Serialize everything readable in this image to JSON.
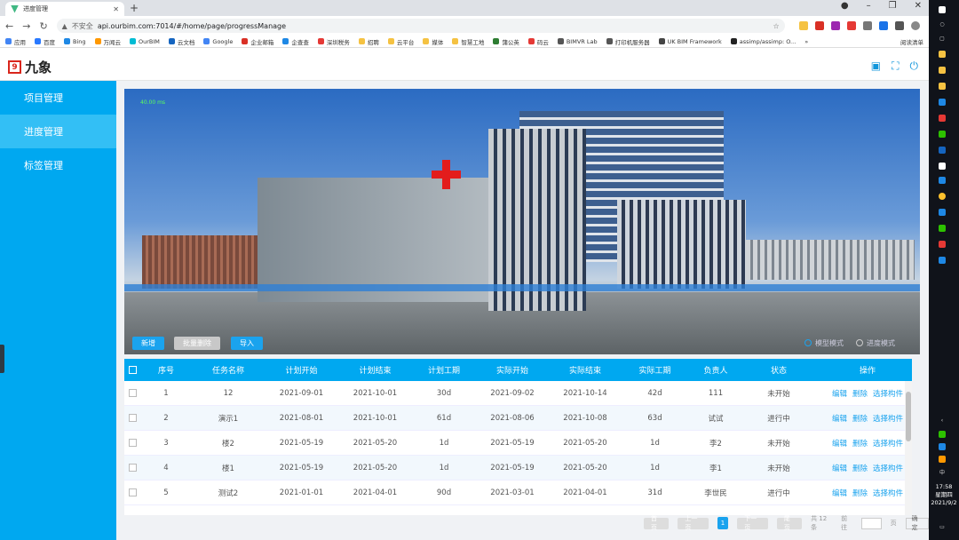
{
  "browser": {
    "tab_title": "进度管理",
    "new_tab": "+",
    "insecure_label": "不安全",
    "url": "api.ourbim.com:7014/#/home/page/progressManage",
    "bookmarks": [
      "应用",
      "百度",
      "Bing",
      "万闻云",
      "OurBIM",
      "云文档",
      "Google",
      "企业邮箱",
      "企查查",
      "深圳税务",
      "招聘",
      "云平台",
      "媒体",
      "智慧工地",
      "蒲公英",
      "码云",
      "BIMVR Lab",
      "打印机服务器",
      "UK BIM Framework",
      "assimp/assimp: O..."
    ],
    "more_bookmarks": "»",
    "reading_list": "阅读清单"
  },
  "app": {
    "logo_text": "九象",
    "logo_mark": "9"
  },
  "sidebar": {
    "items": [
      {
        "label": "项目管理",
        "active": false
      },
      {
        "label": "进度管理",
        "active": true
      },
      {
        "label": "标签管理",
        "active": false
      }
    ]
  },
  "viewport": {
    "fps": "40.00 ms",
    "buttons": {
      "add": "新增",
      "batch_delete": "批量删除",
      "import": "导入"
    },
    "modes": {
      "model": "模型模式",
      "progress": "进度模式"
    }
  },
  "table": {
    "headers": [
      "序号",
      "任务名称",
      "计划开始",
      "计划结束",
      "计划工期",
      "实际开始",
      "实际结束",
      "实际工期",
      "负责人",
      "状态",
      "操作"
    ],
    "ops": {
      "edit": "编辑",
      "delete": "删除",
      "select": "选择构件"
    },
    "rows": [
      [
        "1",
        "12",
        "2021-09-01",
        "2021-10-01",
        "30d",
        "2021-09-02",
        "2021-10-14",
        "42d",
        "111",
        "未开始"
      ],
      [
        "2",
        "演示1",
        "2021-08-01",
        "2021-10-01",
        "61d",
        "2021-08-06",
        "2021-10-08",
        "63d",
        "试试",
        "进行中"
      ],
      [
        "3",
        "楼2",
        "2021-05-19",
        "2021-05-20",
        "1d",
        "2021-05-19",
        "2021-05-20",
        "1d",
        "李2",
        "未开始"
      ],
      [
        "4",
        "楼1",
        "2021-05-19",
        "2021-05-20",
        "1d",
        "2021-05-19",
        "2021-05-20",
        "1d",
        "李1",
        "未开始"
      ],
      [
        "5",
        "测试2",
        "2021-01-01",
        "2021-04-01",
        "90d",
        "2021-03-01",
        "2021-04-01",
        "31d",
        "李世民",
        "进行中"
      ]
    ]
  },
  "pager": {
    "first": "首页",
    "prev": "上一页",
    "current": "1",
    "next": "下一页",
    "last": "尾页",
    "total": "共 12 条",
    "goto": "前往",
    "page_unit": "页",
    "confirm": "确定"
  },
  "taskbar": {
    "time": "17:58",
    "weekday": "星期四",
    "date": "2021/9/2",
    "ime": "中"
  }
}
